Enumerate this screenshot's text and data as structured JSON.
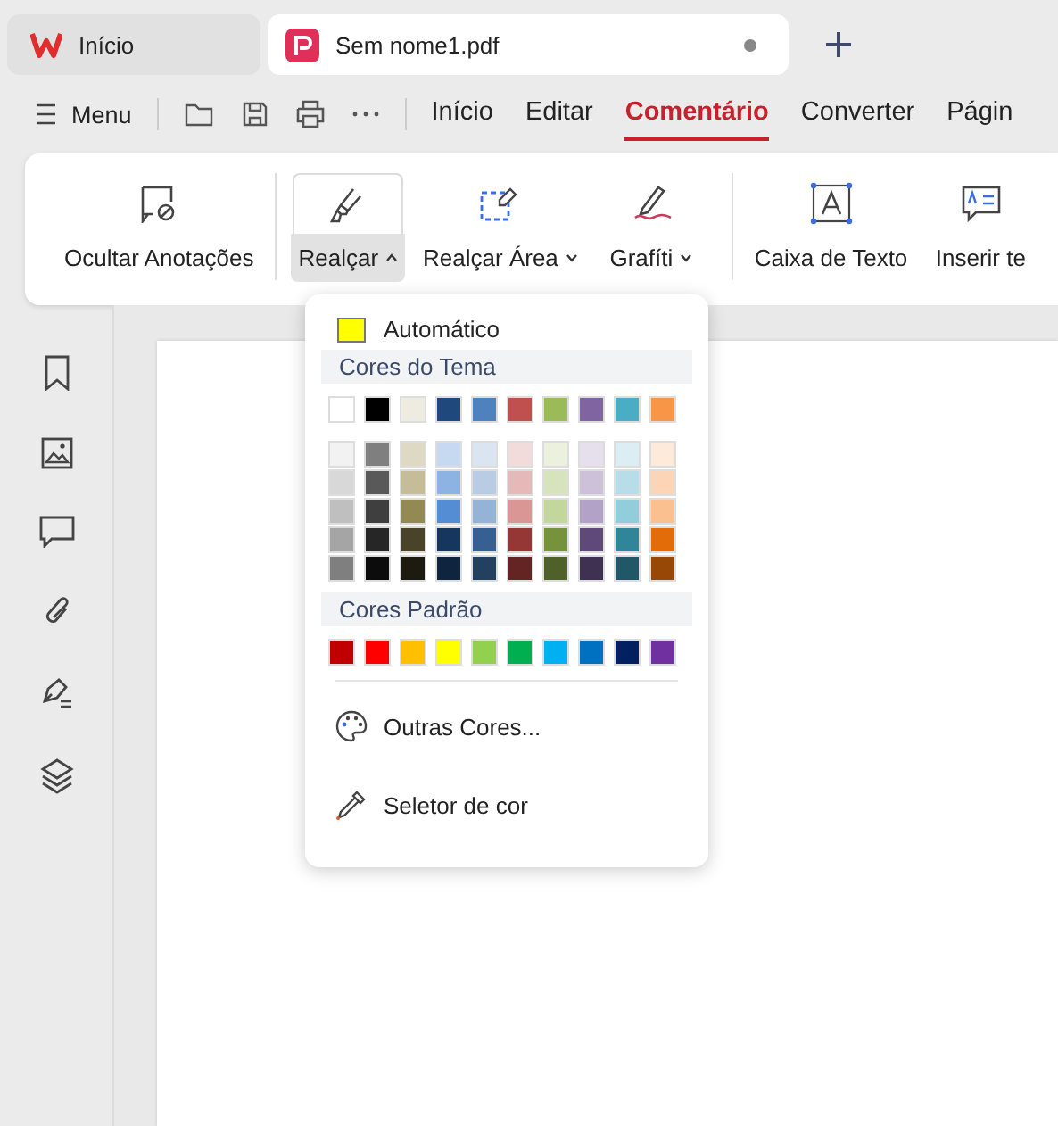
{
  "tabs": [
    {
      "label": "Início",
      "kind": "home",
      "selected": false,
      "unsaved": false
    },
    {
      "label": "Sem nome1.pdf",
      "kind": "pdf",
      "selected": true,
      "unsaved": true
    }
  ],
  "menu": {
    "label": "Menu"
  },
  "nav_tabs": [
    {
      "label": "Início",
      "selected": false
    },
    {
      "label": "Editar",
      "selected": false
    },
    {
      "label": "Comentário",
      "selected": true
    },
    {
      "label": "Converter",
      "selected": false
    },
    {
      "label": "Págin",
      "selected": false
    }
  ],
  "ribbon": [
    {
      "label": "Ocultar Anotações",
      "kind": "hide",
      "dropdown": false,
      "open": false
    },
    {
      "label": "Realçar",
      "kind": "highlight",
      "dropdown": true,
      "open": true
    },
    {
      "label": "Realçar Área",
      "kind": "area",
      "dropdown": true,
      "open": false
    },
    {
      "label": "Grafíti",
      "kind": "pen",
      "dropdown": true,
      "open": false
    },
    {
      "label": "Caixa de Texto",
      "kind": "textbox",
      "dropdown": false,
      "open": false
    },
    {
      "label": "Inserir te",
      "kind": "inserttext",
      "dropdown": false,
      "open": false
    }
  ],
  "color_menu": {
    "automatic": {
      "label": "Automático",
      "color": "#ffff00"
    },
    "theme_title": "Cores do Tema",
    "theme_colors": [
      {
        "color": "#ffffff"
      },
      {
        "color": "#000000"
      },
      {
        "color": "#eeece1"
      },
      {
        "color": "#1f497d"
      },
      {
        "color": "#4f81bd"
      },
      {
        "color": "#c0504d"
      },
      {
        "color": "#9bbb59"
      },
      {
        "color": "#8064a2"
      },
      {
        "color": "#4bacc6"
      },
      {
        "color": "#f79646"
      }
    ],
    "theme_shades": [
      {
        "swatches": [
          {
            "color": "#f2f2f2"
          },
          {
            "color": "#7f7f7f"
          },
          {
            "color": "#ddd9c3"
          },
          {
            "color": "#c6d9f0"
          },
          {
            "color": "#dbe5f1"
          },
          {
            "color": "#f2dcdb"
          },
          {
            "color": "#ebf1dd"
          },
          {
            "color": "#e5e0ec"
          },
          {
            "color": "#dbeef3"
          },
          {
            "color": "#fdeada"
          }
        ]
      },
      {
        "swatches": [
          {
            "color": "#d8d8d8"
          },
          {
            "color": "#595959"
          },
          {
            "color": "#c4bd97"
          },
          {
            "color": "#8db3e2"
          },
          {
            "color": "#b8cce4"
          },
          {
            "color": "#e5b9b7"
          },
          {
            "color": "#d7e3bc"
          },
          {
            "color": "#ccc1d9"
          },
          {
            "color": "#b7dde8"
          },
          {
            "color": "#fbd5b5"
          }
        ]
      },
      {
        "swatches": [
          {
            "color": "#bfbfbf"
          },
          {
            "color": "#3f3f3f"
          },
          {
            "color": "#938953"
          },
          {
            "color": "#548dd4"
          },
          {
            "color": "#95b3d7"
          },
          {
            "color": "#d99694"
          },
          {
            "color": "#c3d69b"
          },
          {
            "color": "#b2a2c7"
          },
          {
            "color": "#92cddc"
          },
          {
            "color": "#fac08f"
          }
        ]
      },
      {
        "swatches": [
          {
            "color": "#a5a5a5"
          },
          {
            "color": "#262626"
          },
          {
            "color": "#494429"
          },
          {
            "color": "#17365d"
          },
          {
            "color": "#366092"
          },
          {
            "color": "#953734"
          },
          {
            "color": "#76923c"
          },
          {
            "color": "#5f497a"
          },
          {
            "color": "#31859b"
          },
          {
            "color": "#e36c09"
          }
        ]
      },
      {
        "swatches": [
          {
            "color": "#7f7f7f"
          },
          {
            "color": "#0c0c0c"
          },
          {
            "color": "#1d1b10"
          },
          {
            "color": "#0f243e"
          },
          {
            "color": "#244061"
          },
          {
            "color": "#632423"
          },
          {
            "color": "#4f6128"
          },
          {
            "color": "#3f3151"
          },
          {
            "color": "#205867"
          },
          {
            "color": "#974806"
          }
        ]
      }
    ],
    "standard_title": "Cores Padrão",
    "standard_colors": [
      {
        "color": "#c00000"
      },
      {
        "color": "#ff0000"
      },
      {
        "color": "#ffc000"
      },
      {
        "color": "#ffff00"
      },
      {
        "color": "#92d050"
      },
      {
        "color": "#00b050"
      },
      {
        "color": "#00b0f0"
      },
      {
        "color": "#0070c0"
      },
      {
        "color": "#002060"
      },
      {
        "color": "#7030a0"
      }
    ],
    "actions": [
      {
        "label": "Outras Cores...",
        "kind": "palette"
      },
      {
        "label": "Seletor de cor",
        "kind": "eyedropper"
      }
    ]
  },
  "sidebar": [
    {
      "kind": "bookmark"
    },
    {
      "kind": "image"
    },
    {
      "kind": "comment"
    },
    {
      "kind": "attachment"
    },
    {
      "kind": "sign"
    },
    {
      "kind": "layers"
    }
  ]
}
